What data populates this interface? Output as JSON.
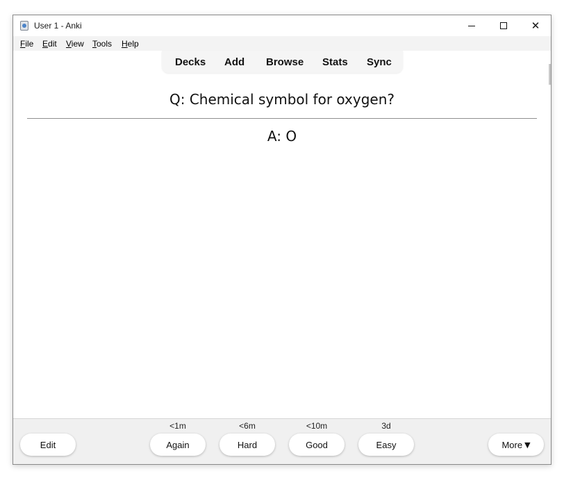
{
  "window": {
    "title": "User 1 - Anki",
    "controls": {
      "minimize": "—",
      "maximize": "☐",
      "close": "✕"
    }
  },
  "menu": [
    {
      "mnemonic": "F",
      "rest": "ile"
    },
    {
      "mnemonic": "E",
      "rest": "dit"
    },
    {
      "mnemonic": "V",
      "rest": "iew"
    },
    {
      "mnemonic": "T",
      "rest": "ools"
    },
    {
      "mnemonic": "H",
      "rest": "elp"
    }
  ],
  "toolbar": {
    "decks": "Decks",
    "add": "Add",
    "browse": "Browse",
    "stats": "Stats",
    "sync": "Sync"
  },
  "card": {
    "question": "Q: Chemical symbol for oxygen?",
    "answer": "A: O"
  },
  "bottom": {
    "edit": "Edit",
    "answers": [
      {
        "interval": "<1m",
        "label": "Again"
      },
      {
        "interval": "<6m",
        "label": "Hard"
      },
      {
        "interval": "<10m",
        "label": "Good"
      },
      {
        "interval": "3d",
        "label": "Easy"
      }
    ],
    "more": "More",
    "more_icon": "▼"
  }
}
